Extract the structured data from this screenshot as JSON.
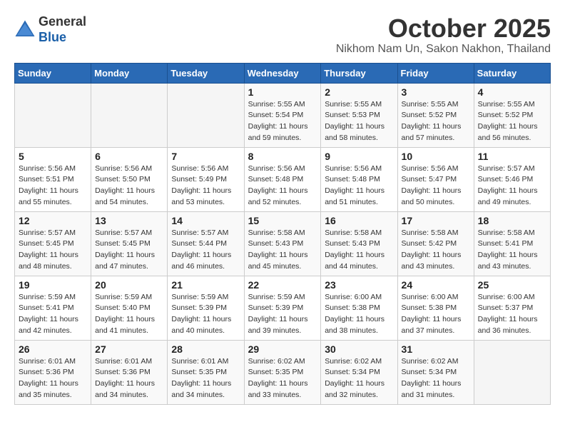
{
  "header": {
    "logo_line1": "General",
    "logo_line2": "Blue",
    "month_title": "October 2025",
    "subtitle": "Nikhom Nam Un, Sakon Nakhon, Thailand"
  },
  "weekdays": [
    "Sunday",
    "Monday",
    "Tuesday",
    "Wednesday",
    "Thursday",
    "Friday",
    "Saturday"
  ],
  "weeks": [
    [
      {
        "day": "",
        "sunrise": "",
        "sunset": "",
        "daylight": ""
      },
      {
        "day": "",
        "sunrise": "",
        "sunset": "",
        "daylight": ""
      },
      {
        "day": "",
        "sunrise": "",
        "sunset": "",
        "daylight": ""
      },
      {
        "day": "1",
        "sunrise": "Sunrise: 5:55 AM",
        "sunset": "Sunset: 5:54 PM",
        "daylight": "Daylight: 11 hours and 59 minutes."
      },
      {
        "day": "2",
        "sunrise": "Sunrise: 5:55 AM",
        "sunset": "Sunset: 5:53 PM",
        "daylight": "Daylight: 11 hours and 58 minutes."
      },
      {
        "day": "3",
        "sunrise": "Sunrise: 5:55 AM",
        "sunset": "Sunset: 5:52 PM",
        "daylight": "Daylight: 11 hours and 57 minutes."
      },
      {
        "day": "4",
        "sunrise": "Sunrise: 5:55 AM",
        "sunset": "Sunset: 5:52 PM",
        "daylight": "Daylight: 11 hours and 56 minutes."
      }
    ],
    [
      {
        "day": "5",
        "sunrise": "Sunrise: 5:56 AM",
        "sunset": "Sunset: 5:51 PM",
        "daylight": "Daylight: 11 hours and 55 minutes."
      },
      {
        "day": "6",
        "sunrise": "Sunrise: 5:56 AM",
        "sunset": "Sunset: 5:50 PM",
        "daylight": "Daylight: 11 hours and 54 minutes."
      },
      {
        "day": "7",
        "sunrise": "Sunrise: 5:56 AM",
        "sunset": "Sunset: 5:49 PM",
        "daylight": "Daylight: 11 hours and 53 minutes."
      },
      {
        "day": "8",
        "sunrise": "Sunrise: 5:56 AM",
        "sunset": "Sunset: 5:48 PM",
        "daylight": "Daylight: 11 hours and 52 minutes."
      },
      {
        "day": "9",
        "sunrise": "Sunrise: 5:56 AM",
        "sunset": "Sunset: 5:48 PM",
        "daylight": "Daylight: 11 hours and 51 minutes."
      },
      {
        "day": "10",
        "sunrise": "Sunrise: 5:56 AM",
        "sunset": "Sunset: 5:47 PM",
        "daylight": "Daylight: 11 hours and 50 minutes."
      },
      {
        "day": "11",
        "sunrise": "Sunrise: 5:57 AM",
        "sunset": "Sunset: 5:46 PM",
        "daylight": "Daylight: 11 hours and 49 minutes."
      }
    ],
    [
      {
        "day": "12",
        "sunrise": "Sunrise: 5:57 AM",
        "sunset": "Sunset: 5:45 PM",
        "daylight": "Daylight: 11 hours and 48 minutes."
      },
      {
        "day": "13",
        "sunrise": "Sunrise: 5:57 AM",
        "sunset": "Sunset: 5:45 PM",
        "daylight": "Daylight: 11 hours and 47 minutes."
      },
      {
        "day": "14",
        "sunrise": "Sunrise: 5:57 AM",
        "sunset": "Sunset: 5:44 PM",
        "daylight": "Daylight: 11 hours and 46 minutes."
      },
      {
        "day": "15",
        "sunrise": "Sunrise: 5:58 AM",
        "sunset": "Sunset: 5:43 PM",
        "daylight": "Daylight: 11 hours and 45 minutes."
      },
      {
        "day": "16",
        "sunrise": "Sunrise: 5:58 AM",
        "sunset": "Sunset: 5:43 PM",
        "daylight": "Daylight: 11 hours and 44 minutes."
      },
      {
        "day": "17",
        "sunrise": "Sunrise: 5:58 AM",
        "sunset": "Sunset: 5:42 PM",
        "daylight": "Daylight: 11 hours and 43 minutes."
      },
      {
        "day": "18",
        "sunrise": "Sunrise: 5:58 AM",
        "sunset": "Sunset: 5:41 PM",
        "daylight": "Daylight: 11 hours and 43 minutes."
      }
    ],
    [
      {
        "day": "19",
        "sunrise": "Sunrise: 5:59 AM",
        "sunset": "Sunset: 5:41 PM",
        "daylight": "Daylight: 11 hours and 42 minutes."
      },
      {
        "day": "20",
        "sunrise": "Sunrise: 5:59 AM",
        "sunset": "Sunset: 5:40 PM",
        "daylight": "Daylight: 11 hours and 41 minutes."
      },
      {
        "day": "21",
        "sunrise": "Sunrise: 5:59 AM",
        "sunset": "Sunset: 5:39 PM",
        "daylight": "Daylight: 11 hours and 40 minutes."
      },
      {
        "day": "22",
        "sunrise": "Sunrise: 5:59 AM",
        "sunset": "Sunset: 5:39 PM",
        "daylight": "Daylight: 11 hours and 39 minutes."
      },
      {
        "day": "23",
        "sunrise": "Sunrise: 6:00 AM",
        "sunset": "Sunset: 5:38 PM",
        "daylight": "Daylight: 11 hours and 38 minutes."
      },
      {
        "day": "24",
        "sunrise": "Sunrise: 6:00 AM",
        "sunset": "Sunset: 5:38 PM",
        "daylight": "Daylight: 11 hours and 37 minutes."
      },
      {
        "day": "25",
        "sunrise": "Sunrise: 6:00 AM",
        "sunset": "Sunset: 5:37 PM",
        "daylight": "Daylight: 11 hours and 36 minutes."
      }
    ],
    [
      {
        "day": "26",
        "sunrise": "Sunrise: 6:01 AM",
        "sunset": "Sunset: 5:36 PM",
        "daylight": "Daylight: 11 hours and 35 minutes."
      },
      {
        "day": "27",
        "sunrise": "Sunrise: 6:01 AM",
        "sunset": "Sunset: 5:36 PM",
        "daylight": "Daylight: 11 hours and 34 minutes."
      },
      {
        "day": "28",
        "sunrise": "Sunrise: 6:01 AM",
        "sunset": "Sunset: 5:35 PM",
        "daylight": "Daylight: 11 hours and 34 minutes."
      },
      {
        "day": "29",
        "sunrise": "Sunrise: 6:02 AM",
        "sunset": "Sunset: 5:35 PM",
        "daylight": "Daylight: 11 hours and 33 minutes."
      },
      {
        "day": "30",
        "sunrise": "Sunrise: 6:02 AM",
        "sunset": "Sunset: 5:34 PM",
        "daylight": "Daylight: 11 hours and 32 minutes."
      },
      {
        "day": "31",
        "sunrise": "Sunrise: 6:02 AM",
        "sunset": "Sunset: 5:34 PM",
        "daylight": "Daylight: 11 hours and 31 minutes."
      },
      {
        "day": "",
        "sunrise": "",
        "sunset": "",
        "daylight": ""
      }
    ]
  ]
}
